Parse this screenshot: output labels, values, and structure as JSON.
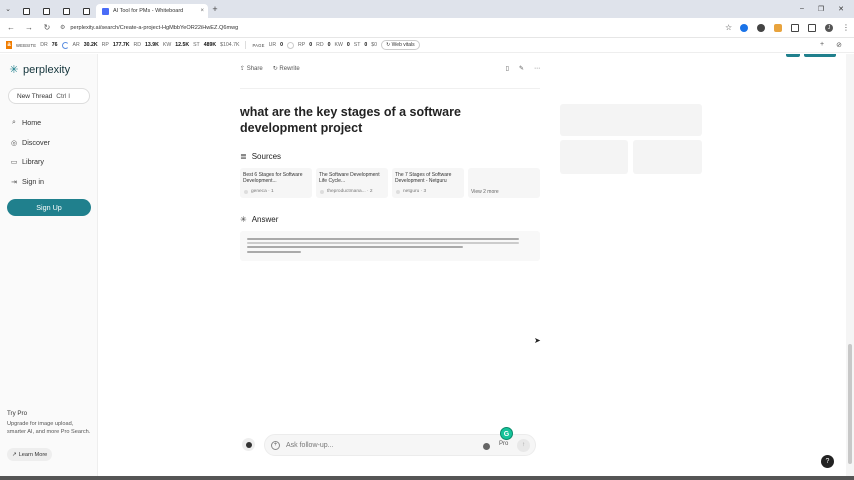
{
  "browser": {
    "tab_title": "AI Tool for PMs - Whiteboard",
    "tab_close": "×",
    "new_tab": "+",
    "url": "perplexity.ai/search/Create-a-project-HgMbbYeOR22iHwEZ.Q6mwg",
    "window_controls": [
      "–",
      "❐",
      "✕"
    ]
  },
  "seo": {
    "website_label": "WEBSITE",
    "dr_label": "DR",
    "dr_value": "76",
    "ar_label": "AR",
    "ar_value": "30.2K",
    "rp_label": "RP",
    "rp_value": "177.7K",
    "rd_label": "RD",
    "rd_value": "13.9K",
    "kw_label": "KW",
    "kw_value": "12.5K",
    "st_label": "ST",
    "st_value": "489K",
    "st_extra": "$104.7K",
    "page_label": "PAGE",
    "ur_label": "UR",
    "ur_value": "0",
    "prp_label": "RP",
    "prp_value": "0",
    "prd_label": "RD",
    "prd_value": "0",
    "pkw_label": "KW",
    "pkw_value": "0",
    "pst_label": "ST",
    "pst_value": "0",
    "pst_extra": "$0",
    "web_vitals": "Web vitals"
  },
  "sidebar": {
    "brand": "perplexity",
    "new_thread": "New Thread",
    "shortcut": "Ctrl  I",
    "nav": [
      {
        "label": "Home",
        "icon": "search-icon"
      },
      {
        "label": "Discover",
        "icon": "compass-icon"
      },
      {
        "label": "Library",
        "icon": "library-icon"
      },
      {
        "label": "Sign in",
        "icon": "signin-icon"
      }
    ],
    "signup": "Sign Up",
    "try_pro": "Try Pro",
    "try_pro_desc": "Upgrade for image upload, smarter AI, and more Pro Search.",
    "learn_more": "Learn More"
  },
  "thread": {
    "share": "Share",
    "rewrite": "Rewrite",
    "question": "what are the key stages of a software development project",
    "sources_heading": "Sources",
    "sources": [
      {
        "title": "Best 6 Stages for Software Development...",
        "meta": "geneca · 1"
      },
      {
        "title": "The Software Development Life Cycle...",
        "meta": "theproductmana... · 2"
      },
      {
        "title": "The 7 Stages of Software Development - Netguru",
        "meta": "netguru · 3"
      }
    ],
    "view_more": "View 2 more",
    "answer_heading": "Answer"
  },
  "followup": {
    "placeholder": "Ask follow-up...",
    "pro": "Pro"
  },
  "help": "?",
  "colors": {
    "accent": "#20808d",
    "grammarly": "#15c39a"
  }
}
